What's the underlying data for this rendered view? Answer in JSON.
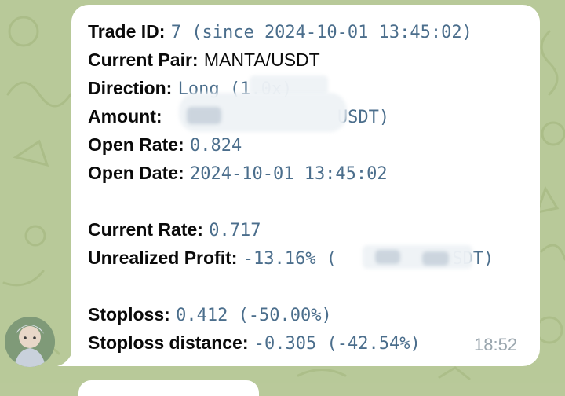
{
  "message": {
    "trade_id": {
      "label": "Trade ID:",
      "value": "7 (since 2024-10-01 13:45:02)"
    },
    "current_pair": {
      "label": "Current Pair:",
      "value": "MANTA/USDT"
    },
    "direction": {
      "label": "Direction:",
      "value": "Long (1.0x)"
    },
    "amount": {
      "label": "Amount:",
      "value": "USDT)"
    },
    "open_rate": {
      "label": "Open Rate:",
      "value": "0.824"
    },
    "open_date": {
      "label": "Open Date:",
      "value": "2024-10-01 13:45:02"
    },
    "current_rate": {
      "label": "Current Rate:",
      "value": "0.717"
    },
    "unrealized_profit": {
      "label": "Unrealized Profit:",
      "value": "-13.16% (",
      "value_tail": "SDT)"
    },
    "stoploss": {
      "label": "Stoploss:",
      "value": "0.412 (-50.00%)"
    },
    "stoploss_distance": {
      "label": "Stoploss distance:",
      "value": "-0.305 (-42.54%)"
    },
    "time": "18:52"
  },
  "colors": {
    "bubble": "#ffffff",
    "value_text": "#4b6e8c",
    "label_text": "#0a0a0a",
    "timestamp": "#9aa6ae",
    "wallpaper": "#b9c99a"
  },
  "icons": {
    "avatar": "user-avatar"
  }
}
